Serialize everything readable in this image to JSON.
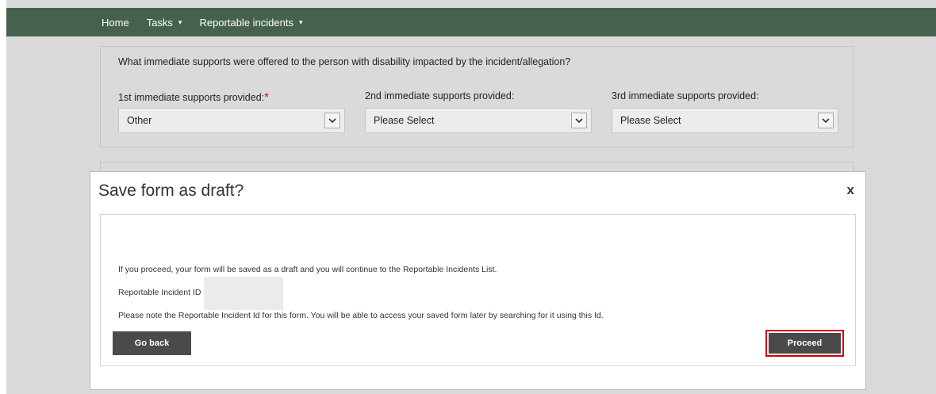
{
  "nav": {
    "home": "Home",
    "tasks": "Tasks",
    "reportable": "Reportable incidents",
    "caret": "▾"
  },
  "form": {
    "question": "What immediate supports were offered to the person with disability impacted by the incident/allegation?",
    "fields": [
      {
        "label": "1st immediate supports provided:",
        "required": "*",
        "value": "Other"
      },
      {
        "label": "2nd immediate supports provided:",
        "value": "Please Select"
      },
      {
        "label": "3rd immediate supports provided:",
        "value": "Please Select"
      }
    ]
  },
  "modal": {
    "title": "Save form as draft?",
    "close": "x",
    "message": "If you proceed, your form will be saved as a draft and you will continue to the Reportable Incidents List.",
    "id_label": "Reportable Incident ID",
    "note": "Please note the Reportable Incident Id for this form. You will be able to access your saved form later by searching for it using this Id.",
    "back_label": "Go back",
    "proceed_label": "Proceed"
  },
  "colors": {
    "navbar": "#46624f",
    "page_bg": "#d9d9d9",
    "button": "#4a4a4a",
    "highlight": "#d00000",
    "required": "#c0182f"
  },
  "icons": {
    "dropdown": "chevron-down-icon",
    "close": "close-icon"
  }
}
